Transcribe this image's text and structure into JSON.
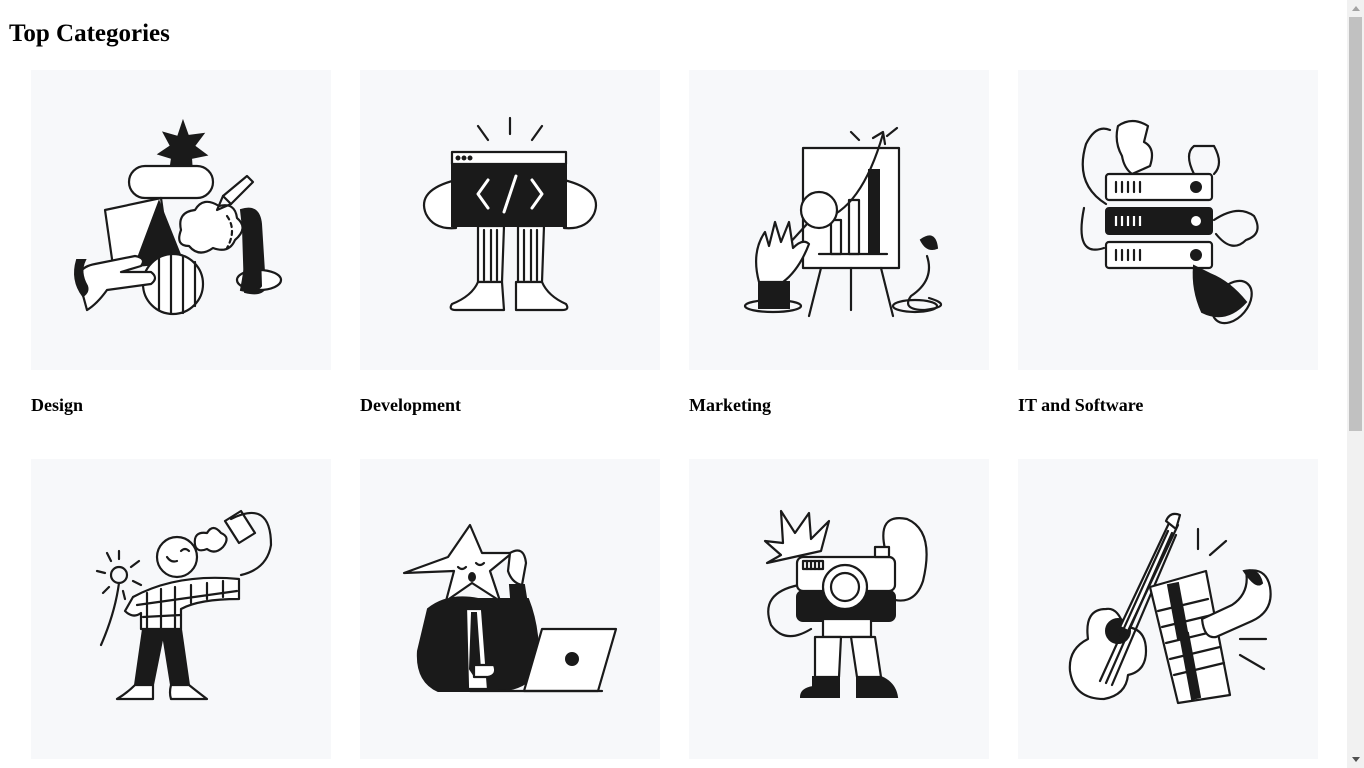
{
  "page": {
    "title": "Top Categories"
  },
  "categories": [
    {
      "label": "Design",
      "illustration": "design-illustration"
    },
    {
      "label": "Development",
      "illustration": "development-illustration"
    },
    {
      "label": "Marketing",
      "illustration": "marketing-illustration"
    },
    {
      "label": "IT and Software",
      "illustration": "it-software-illustration"
    },
    {
      "label": "",
      "illustration": "personal-development-illustration"
    },
    {
      "label": "",
      "illustration": "business-illustration"
    },
    {
      "label": "",
      "illustration": "photography-illustration"
    },
    {
      "label": "",
      "illustration": "music-illustration"
    }
  ],
  "colors": {
    "card_background": "#f7f8fa",
    "ink": "#1a1a1a",
    "scrollbar_track": "#f1f1f1",
    "scrollbar_thumb": "#c1c1c1"
  }
}
